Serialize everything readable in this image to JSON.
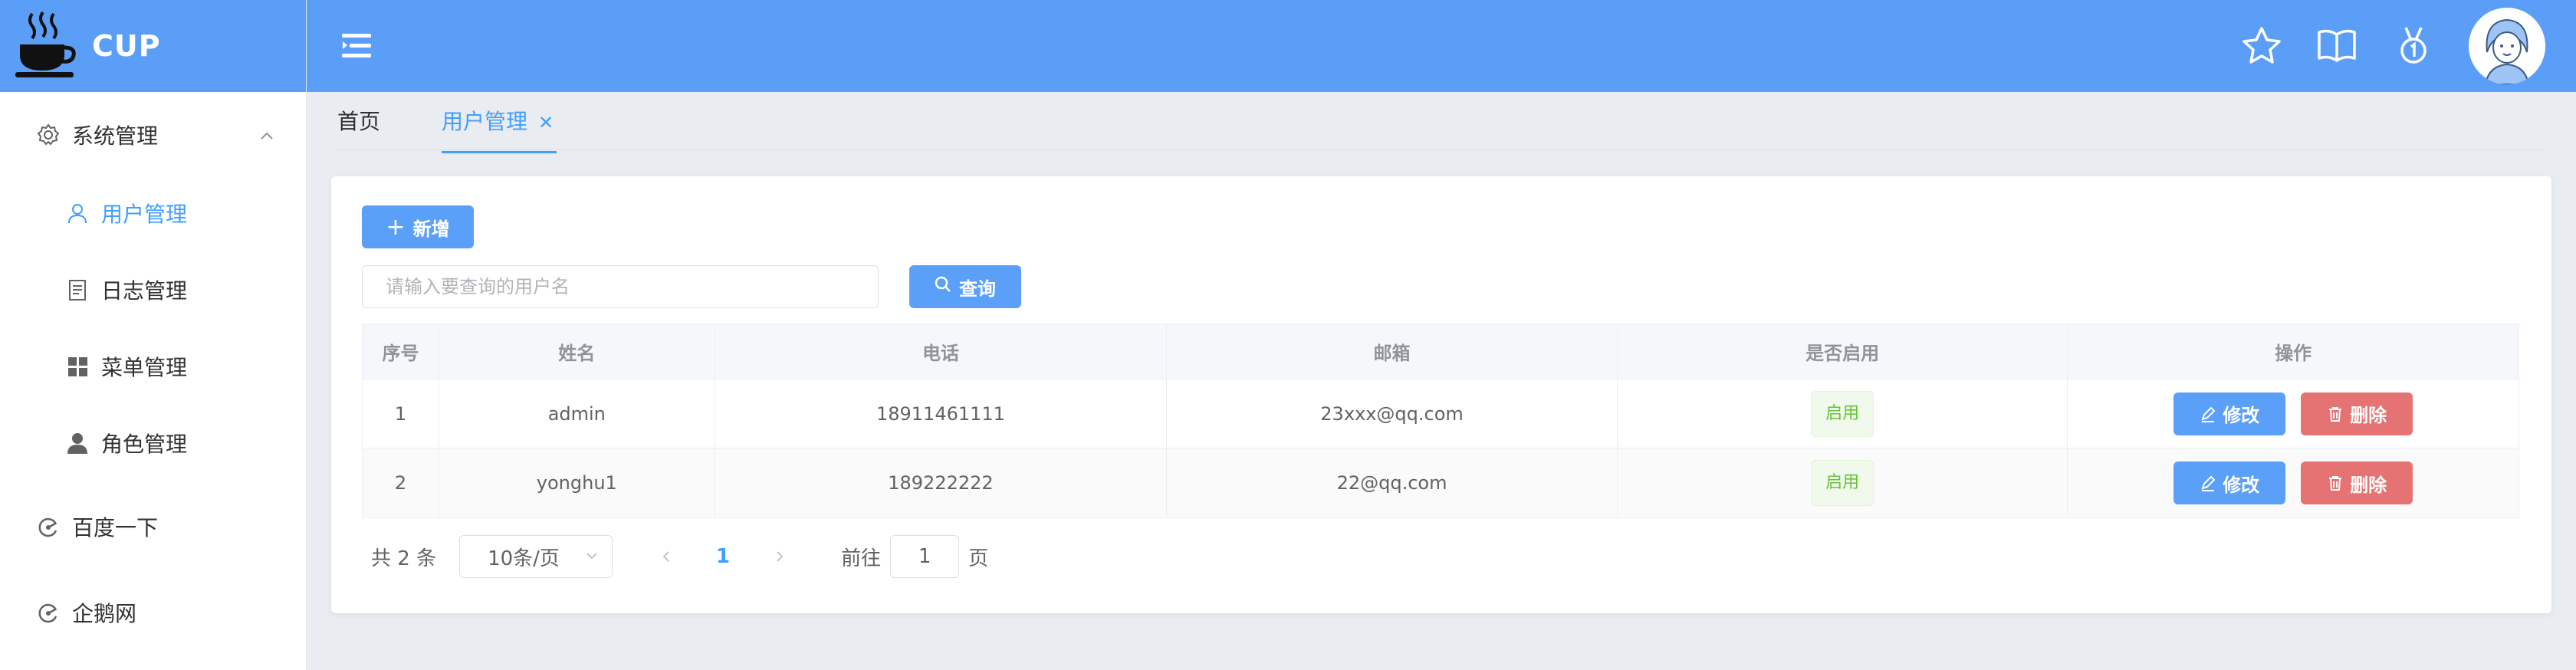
{
  "app": {
    "brand": "CUP",
    "logo_icon": "coffee-cup-icon"
  },
  "sidebar": {
    "groups": [
      {
        "label": "系统管理",
        "icon": "gear-icon",
        "expanded": true,
        "children": [
          {
            "label": "用户管理",
            "icon": "user-icon",
            "active": true
          },
          {
            "label": "日志管理",
            "icon": "document-icon",
            "active": false
          },
          {
            "label": "菜单管理",
            "icon": "grid-icon",
            "active": false
          },
          {
            "label": "角色管理",
            "icon": "person-icon",
            "active": false
          }
        ]
      }
    ],
    "links": [
      {
        "label": "百度一下",
        "icon": "link-icon"
      },
      {
        "label": "企鹅网",
        "icon": "link-icon"
      }
    ]
  },
  "header": {
    "icons": [
      "star-icon",
      "book-icon",
      "medal-icon"
    ],
    "avatar": "user-avatar"
  },
  "tabs": [
    {
      "label": "首页",
      "active": false,
      "closable": false
    },
    {
      "label": "用户管理",
      "active": true,
      "closable": true
    }
  ],
  "toolbar": {
    "add_label": "新增",
    "search_placeholder": "请输入要查询的用户名",
    "search_value": "",
    "search_label": "查询"
  },
  "table": {
    "columns": [
      "序号",
      "姓名",
      "电话",
      "邮箱",
      "是否启用",
      "操作"
    ],
    "rows": [
      {
        "index": "1",
        "name": "admin",
        "phone": "18911461111",
        "email": "23xxx@qq.com",
        "status": "启用"
      },
      {
        "index": "2",
        "name": "yonghu1",
        "phone": "189222222",
        "email": "22@qq.com",
        "status": "启用"
      }
    ],
    "actions": {
      "edit_label": "修改",
      "delete_label": "删除"
    }
  },
  "pagination": {
    "total_text": "共 2 条",
    "page_size": "10条/页",
    "current_page": "1",
    "goto_label": "前往",
    "goto_value": "1",
    "page_suffix": "页"
  },
  "colors": {
    "header_bg": "#5b9ef8",
    "primary": "#409eff",
    "success": "#67c23a",
    "danger": "#e57373"
  }
}
